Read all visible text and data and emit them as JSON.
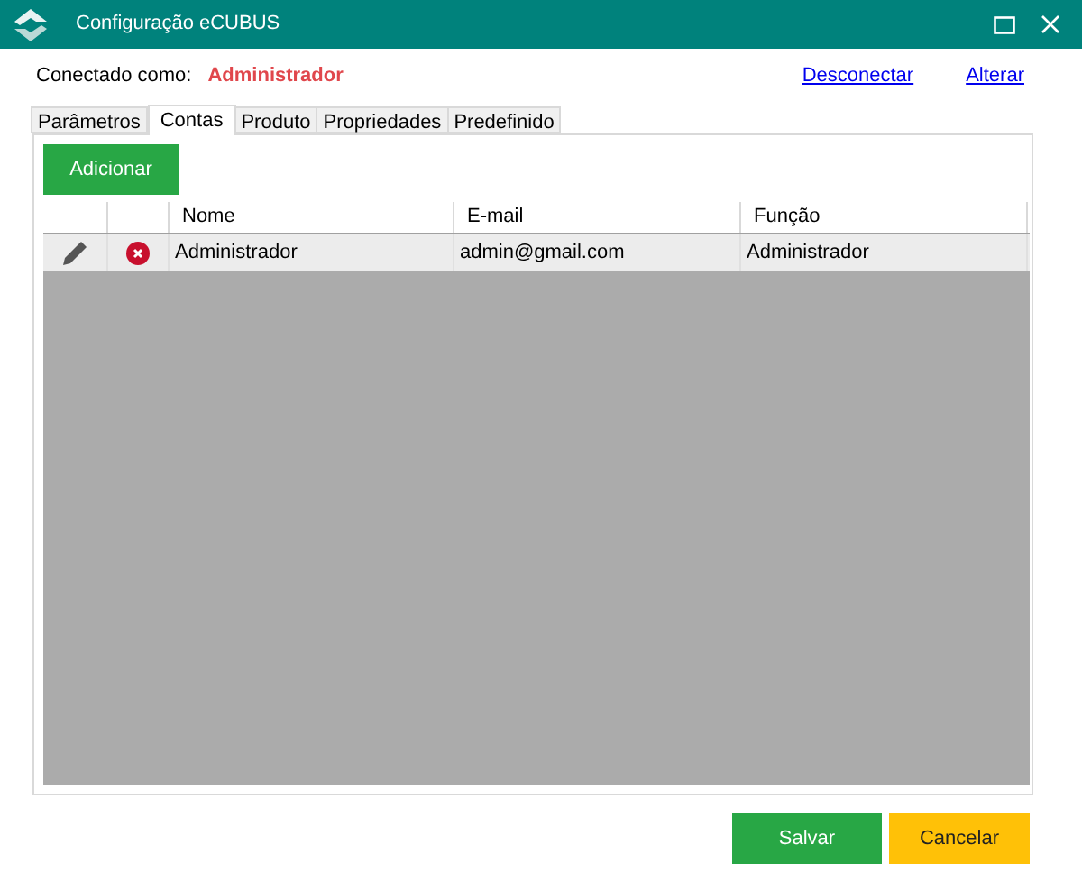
{
  "window": {
    "title": "Configuração eCUBUS"
  },
  "connection": {
    "label": "Conectado como:",
    "user": "Administrador",
    "links": [
      "Desconectar",
      "Alterar"
    ]
  },
  "tabs": [
    {
      "label": "Parâmetros",
      "selected": false
    },
    {
      "label": "Contas",
      "selected": true
    },
    {
      "label": "Produto",
      "selected": false
    },
    {
      "label": "Propriedades",
      "selected": false
    },
    {
      "label": "Predefinido",
      "selected": false
    }
  ],
  "add_button": "Adicionar",
  "table": {
    "columns": [
      "Nome",
      "E-mail",
      "Função"
    ],
    "rows": [
      {
        "cells": [
          "Administrador",
          "admin@gmail.com",
          "Administrador"
        ]
      }
    ]
  },
  "buttons": [
    {
      "label": "Salvar",
      "kind": "primary"
    },
    {
      "label": "Cancelar",
      "kind": "warning"
    }
  ]
}
